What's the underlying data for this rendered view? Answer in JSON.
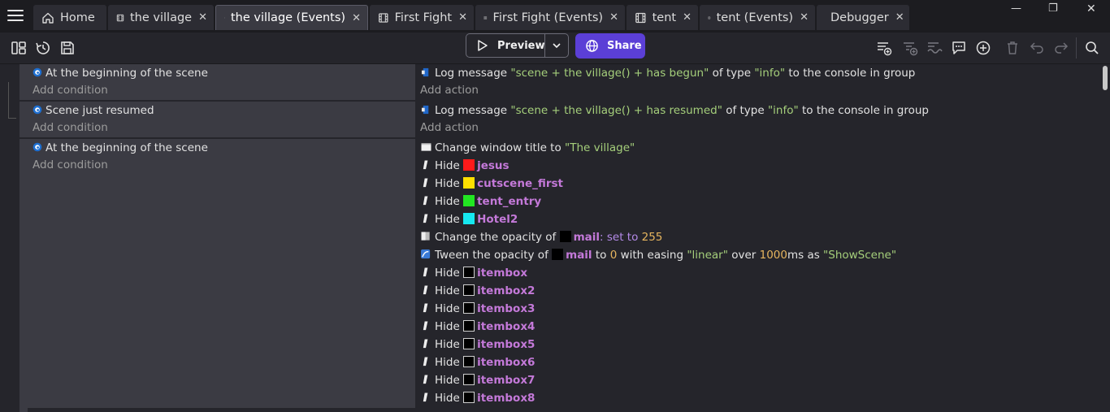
{
  "tabs": [
    {
      "label": "Home",
      "icon": "home-icon",
      "closable": false
    },
    {
      "label": "the village",
      "icon": "film-icon",
      "closable": true
    },
    {
      "label": "the village (Events)",
      "icon": "events-icon",
      "closable": true,
      "active": true
    },
    {
      "label": "First Fight",
      "icon": "film-icon",
      "closable": true
    },
    {
      "label": "First Fight (Events)",
      "icon": "events-icon",
      "closable": true
    },
    {
      "label": "tent",
      "icon": "film-icon",
      "closable": true
    },
    {
      "label": "tent (Events)",
      "icon": "events-icon",
      "closable": true
    },
    {
      "label": "Debugger",
      "icon": "bug-icon",
      "closable": true
    }
  ],
  "close_glyph": "✕",
  "window": {
    "minimize": "—",
    "restore": "❐",
    "close": "✕"
  },
  "toolbar": {
    "preview_label": "Preview",
    "share_label": "Share"
  },
  "events": [
    {
      "condition": "At the beginning of the scene",
      "add_condition": "Add condition",
      "add_action": "Add action",
      "actions": [
        {
          "parts": [
            [
              "t",
              "Log message "
            ],
            [
              "s",
              "\"scene + the village() + has begun\""
            ],
            [
              "t",
              " of type "
            ],
            [
              "s",
              "\"info\""
            ],
            [
              "t",
              " to the console in group"
            ]
          ],
          "icon": "log"
        }
      ]
    },
    {
      "condition": "Scene just resumed",
      "add_condition": "Add condition",
      "add_action": "Add action",
      "actions": [
        {
          "parts": [
            [
              "t",
              "Log message "
            ],
            [
              "s",
              "\"scene + the village() + has resumed\""
            ],
            [
              "t",
              " of type "
            ],
            [
              "s",
              "\"info\""
            ],
            [
              "t",
              " to the console in group"
            ]
          ],
          "icon": "log"
        }
      ]
    },
    {
      "condition": "At the beginning of the scene",
      "add_condition": "Add condition",
      "actions": [
        {
          "parts": [
            [
              "t",
              "Change window title to "
            ],
            [
              "s",
              "\"The village\""
            ]
          ],
          "icon": "window"
        },
        {
          "parts": [
            [
              "t",
              "Hide "
            ],
            [
              "o",
              "jesus"
            ]
          ],
          "icon": "hide",
          "swatch": "#ff1a1a"
        },
        {
          "parts": [
            [
              "t",
              "Hide "
            ],
            [
              "o",
              "cutscene_first"
            ]
          ],
          "icon": "hide",
          "swatch": "#ffe000"
        },
        {
          "parts": [
            [
              "t",
              "Hide "
            ],
            [
              "o",
              "tent_entry"
            ]
          ],
          "icon": "hide",
          "swatch": "#22e622"
        },
        {
          "parts": [
            [
              "t",
              "Hide "
            ],
            [
              "o",
              "Hotel2"
            ]
          ],
          "icon": "hide",
          "swatch": "#16e8f0"
        },
        {
          "parts": [
            [
              "t",
              "Change the opacity of "
            ],
            [
              "o",
              "mail"
            ],
            [
              "k",
              ": set to "
            ],
            [
              "n",
              "255"
            ]
          ],
          "icon": "opacity",
          "swatch": "#000000"
        },
        {
          "parts": [
            [
              "t",
              "Tween the opacity of "
            ],
            [
              "o",
              "mail"
            ],
            [
              "t",
              " to "
            ],
            [
              "n",
              "0"
            ],
            [
              "t",
              " with easing "
            ],
            [
              "s",
              "\"linear\""
            ],
            [
              "t",
              " over "
            ],
            [
              "n",
              "1000"
            ],
            [
              "t",
              "ms as "
            ],
            [
              "s",
              "\"ShowScene\""
            ]
          ],
          "icon": "tween",
          "swatch": "#000000"
        },
        {
          "parts": [
            [
              "t",
              "Hide "
            ],
            [
              "o",
              "itembox"
            ]
          ],
          "icon": "hide",
          "swatch": "#000000",
          "outlined": true
        },
        {
          "parts": [
            [
              "t",
              "Hide "
            ],
            [
              "o",
              "itembox2"
            ]
          ],
          "icon": "hide",
          "swatch": "#000000",
          "outlined": true
        },
        {
          "parts": [
            [
              "t",
              "Hide "
            ],
            [
              "o",
              "itembox3"
            ]
          ],
          "icon": "hide",
          "swatch": "#000000",
          "outlined": true
        },
        {
          "parts": [
            [
              "t",
              "Hide "
            ],
            [
              "o",
              "itembox4"
            ]
          ],
          "icon": "hide",
          "swatch": "#000000",
          "outlined": true
        },
        {
          "parts": [
            [
              "t",
              "Hide "
            ],
            [
              "o",
              "itembox5"
            ]
          ],
          "icon": "hide",
          "swatch": "#000000",
          "outlined": true
        },
        {
          "parts": [
            [
              "t",
              "Hide "
            ],
            [
              "o",
              "itembox6"
            ]
          ],
          "icon": "hide",
          "swatch": "#000000",
          "outlined": true
        },
        {
          "parts": [
            [
              "t",
              "Hide "
            ],
            [
              "o",
              "itembox7"
            ]
          ],
          "icon": "hide",
          "swatch": "#000000",
          "outlined": true
        },
        {
          "parts": [
            [
              "t",
              "Hide "
            ],
            [
              "o",
              "itembox8"
            ]
          ],
          "icon": "hide",
          "swatch": "#000000",
          "outlined": true
        }
      ]
    }
  ],
  "colors": {
    "accent": "#5b3fd6",
    "string": "#a5cf7b",
    "number": "#e6b55e",
    "object": "#c479d9"
  }
}
